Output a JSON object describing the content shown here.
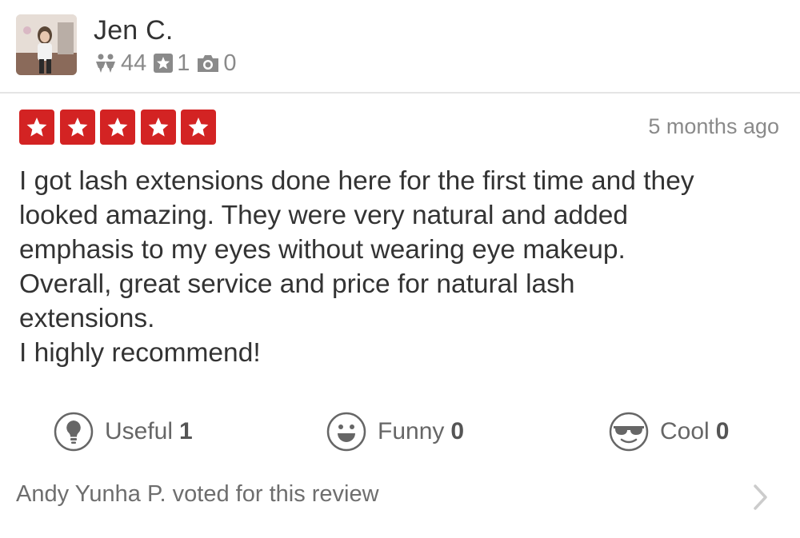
{
  "user": {
    "name": "Jen C.",
    "friends": "44",
    "reviews": "1",
    "photos": "0"
  },
  "review": {
    "rating": 5,
    "time_ago": "5 months ago",
    "text": "I got lash extensions done here for the first time and they\nlooked amazing. They were very natural and added\nemphasis to my eyes without wearing eye makeup.\nOverall, great service and price for natural lash\nextensions.\nI highly recommend!"
  },
  "votes": {
    "useful": {
      "label": "Useful",
      "count": "1"
    },
    "funny": {
      "label": "Funny",
      "count": "0"
    },
    "cool": {
      "label": "Cool",
      "count": "0"
    }
  },
  "voted_by": "Andy Yunha P. voted for this review",
  "colors": {
    "star_red": "#d32323",
    "text_dark": "#333333",
    "text_gray": "#8a8a8a"
  },
  "icons": {
    "friends": "friends-icon",
    "reviews": "review-star-icon",
    "photos": "camera-icon",
    "useful": "lightbulb-icon",
    "funny": "smiley-icon",
    "cool": "sunglasses-icon",
    "chevron": "chevron-right-icon"
  }
}
